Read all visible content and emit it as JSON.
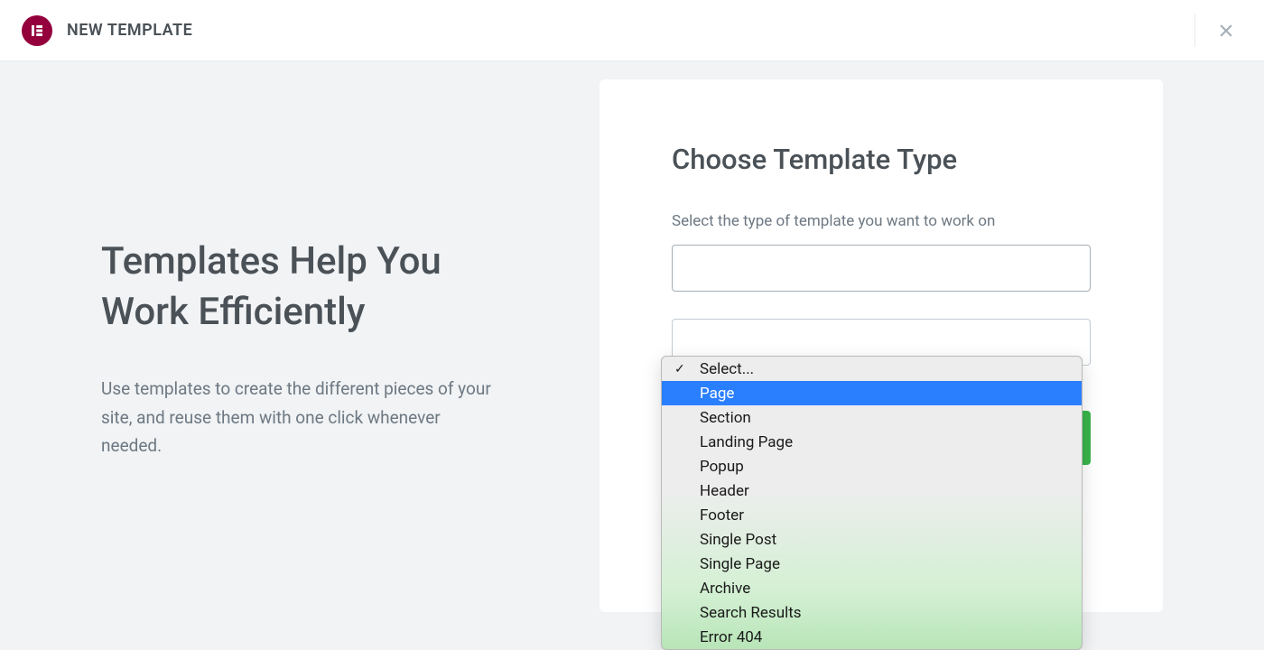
{
  "header": {
    "title": "NEW TEMPLATE"
  },
  "left": {
    "title": "Templates Help You Work Efficiently",
    "description": "Use templates to create the different pieces of your site, and reuse them with one click whenever needed."
  },
  "panel": {
    "title": "Choose Template Type",
    "select_label": "Select the type of template you want to work on",
    "name_placeholder": ""
  },
  "dropdown": {
    "placeholder": "Select...",
    "highlighted_index": 0,
    "options": [
      "Page",
      "Section",
      "Landing Page",
      "Popup",
      "Header",
      "Footer",
      "Single Post",
      "Single Page",
      "Archive",
      "Search Results",
      "Error 404"
    ]
  }
}
